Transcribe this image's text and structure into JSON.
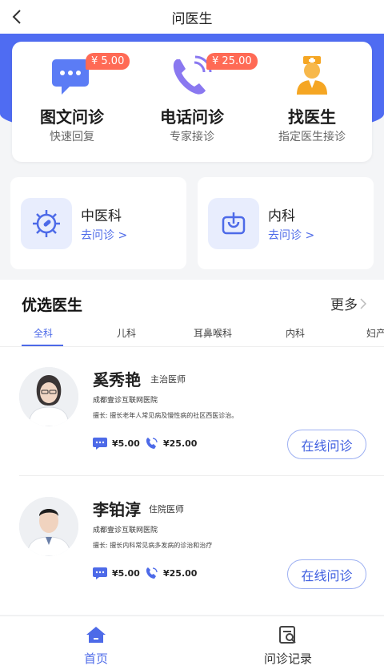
{
  "header": {
    "title": "问医生"
  },
  "services": [
    {
      "name": "图文问诊",
      "sub": "快速回复",
      "price": "¥ 5.00",
      "icon": "chat-bubble-icon"
    },
    {
      "name": "电话问诊",
      "sub": "专家接诊",
      "price": "¥ 25.00",
      "icon": "phone-icon"
    },
    {
      "name": "找医生",
      "sub": "指定医生接诊",
      "icon": "nurse-icon"
    }
  ],
  "departments": [
    {
      "name": "中医科",
      "link": "去问诊 >",
      "icon": "virus-icon"
    },
    {
      "name": "内科",
      "link": "去问诊 >",
      "icon": "internal-icon"
    }
  ],
  "doctors_section": {
    "title": "优选医生",
    "more": "更多",
    "tabs": [
      "全科",
      "儿科",
      "耳鼻喉科",
      "内科",
      "妇产"
    ],
    "active_tab": 0
  },
  "doctors": [
    {
      "name": "奚秀艳",
      "title": "主治医师",
      "hospital": "成都壹诊互联网医院",
      "specialty": "擅长: 擅长老年人常见病及慢性病的社区西医诊治。",
      "text_fee": "¥5.00",
      "phone_fee": "¥25.00",
      "button": "在线问诊"
    },
    {
      "name": "李铂淳",
      "title": "住院医师",
      "hospital": "成都壹诊互联网医院",
      "specialty": "擅长: 擅长内科常见病多发病的诊治和治疗",
      "text_fee": "¥5.00",
      "phone_fee": "¥25.00",
      "button": "在线问诊"
    }
  ],
  "tabbar": [
    {
      "label": "首页",
      "active": true,
      "icon": "home-icon"
    },
    {
      "label": "问诊记录",
      "active": false,
      "icon": "record-icon"
    }
  ],
  "colors": {
    "primary": "#4f6cf2",
    "price_badge": "#ff6a55",
    "link": "#4d6ae8"
  }
}
